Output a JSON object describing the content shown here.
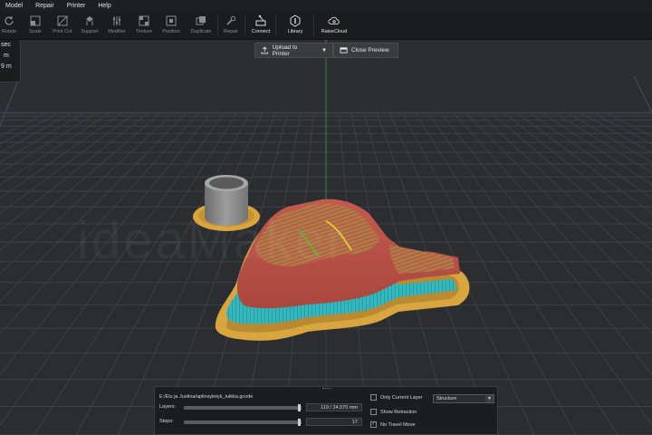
{
  "menu": [
    "Model",
    "Repair",
    "Printer",
    "Help"
  ],
  "toolbar": {
    "tools": [
      "Rotate",
      "Scale",
      "Print Cut",
      "Support",
      "Modifier",
      "Texture",
      "Position",
      "Duplicate",
      "Repair"
    ],
    "actions": [
      "Connect",
      "Library",
      "RaiseCloud"
    ]
  },
  "left_panel": [
    "sec",
    "m",
    "9 m"
  ],
  "preview": {
    "upload": "Upload to Printer",
    "close": "Close Preview"
  },
  "watermark": "ideaMaker",
  "colors": {
    "background": "#2b2d30",
    "grid": "#3b3d41",
    "brim": "#d8a53e",
    "wall": "#c85a4c",
    "fill": "#6fa83a",
    "support": "#3bbcc2",
    "cylinder": "#8c8c8c"
  },
  "layer_panel": {
    "file_path": "E:/Elu ja Justina/aplinsyletyk_tuikka.gcode",
    "layers_label": "Layers:",
    "layers_value": "119 / 24.570 mm",
    "layer_fraction": 0.99,
    "steps_label": "Steps:",
    "steps_value": "17",
    "step_fraction": 0.99,
    "only_current_layer": "Only Current Layer",
    "show_retraction": "Show Retraction",
    "no_travel_move": "No Travel Move",
    "view_mode": "Structure"
  }
}
